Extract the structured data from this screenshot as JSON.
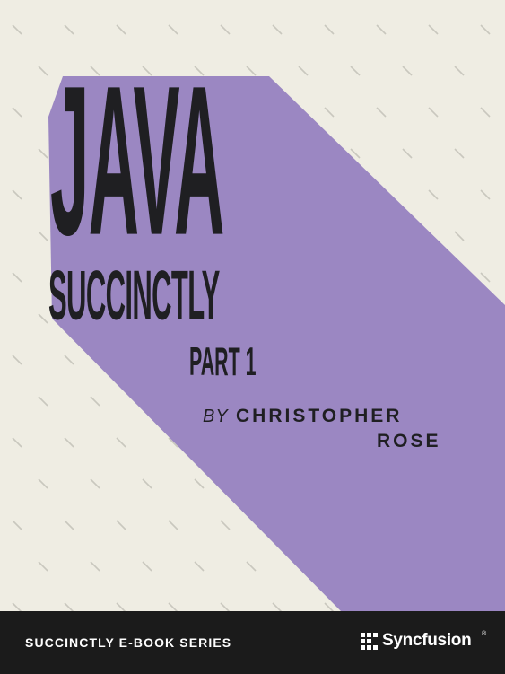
{
  "book": {
    "title_line1": "JAVA",
    "title_line2": "SUCCINCTLY",
    "title_line3": "PART 1",
    "author_prefix": "BY",
    "author_first": "CHRISTOPHER",
    "author_last": "ROSE"
  },
  "footer": {
    "series": "SUCCINCTLY E-BOOK SERIES",
    "brand_name": "Syncfusion",
    "brand_mark": "®"
  },
  "colors": {
    "background": "#efede3",
    "shadow": "#9b87c2",
    "title_text": "#1f1f22",
    "footer_bg": "#1b1b1b",
    "footer_text": "#ffffff",
    "pattern_dash": "#c9c7be"
  },
  "icons": {
    "brand_logo": "syncfusion-grid-logo-icon"
  }
}
